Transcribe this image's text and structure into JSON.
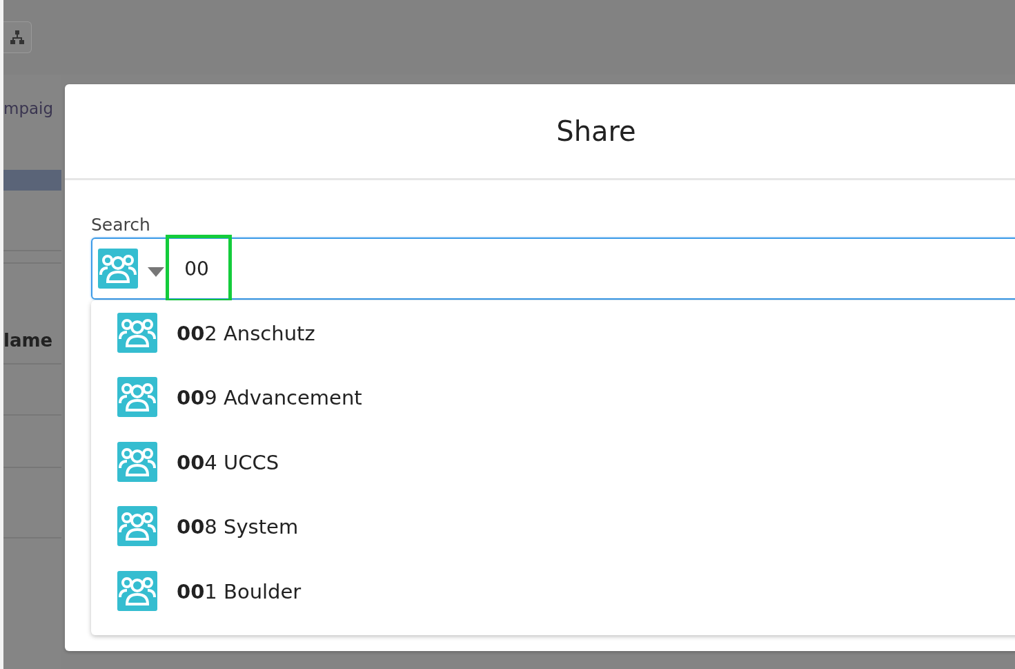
{
  "background": {
    "tab_text": "mpaig",
    "column_header": "lame"
  },
  "dialog": {
    "title": "Share",
    "search": {
      "label": "Search",
      "value": "00"
    },
    "results": [
      {
        "label": "**00**2 Anschutz"
      },
      {
        "label": "**00**9 Advancement"
      },
      {
        "label": "**00**4 UCCS"
      },
      {
        "label": "**00**8 System"
      },
      {
        "label": "**00**1 Boulder"
      }
    ]
  }
}
